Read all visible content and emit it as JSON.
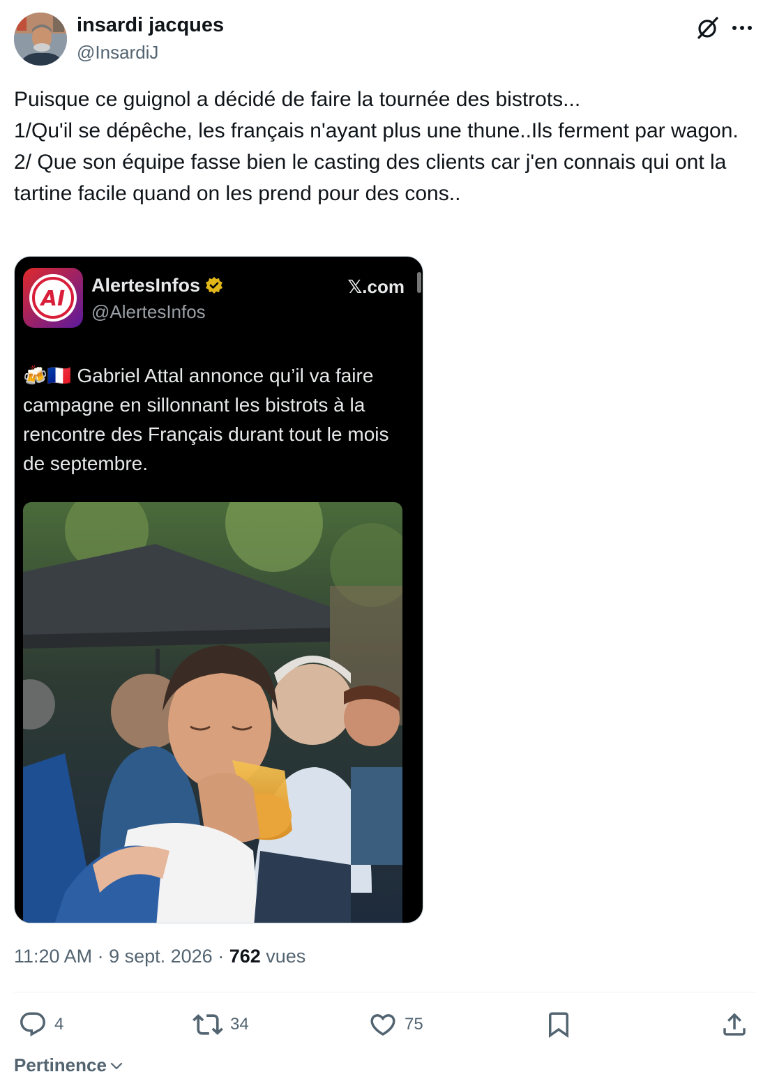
{
  "author": {
    "name": "insardi jacques",
    "handle": "@InsardiJ"
  },
  "post": {
    "lines": [
      "Puisque ce guignol a décidé de faire la tournée des bistrots...",
      "1/Qu'il se dépêche, les français n'ayant plus une thune..Ils ferment par wagon.",
      "2/ Que son équipe fasse bien le casting des clients car j'en connais qui ont la tartine facile quand on les prend pour des cons.."
    ]
  },
  "embed": {
    "logo_text": "AI",
    "name": "AlertesInfos",
    "handle": "@AlertesInfos",
    "source": "𝕏.com",
    "text": "🍻🇫🇷 Gabriel Attal annonce qu’il va faire campagne en sillonnant les bistrots à la rencontre des Français durant tout le mois de septembre."
  },
  "meta": {
    "time_date": "11:20 AM · 9 sept. 2026 · ",
    "views_count": "762",
    "views_label": " vues"
  },
  "actions": {
    "replies": "4",
    "reposts": "34",
    "likes": "75"
  },
  "sort_label": "Pertinence",
  "colors": {
    "text": "#0f1419",
    "secondary": "#536471",
    "verified": "#e2b719",
    "logo_red": "#d91e3a"
  }
}
